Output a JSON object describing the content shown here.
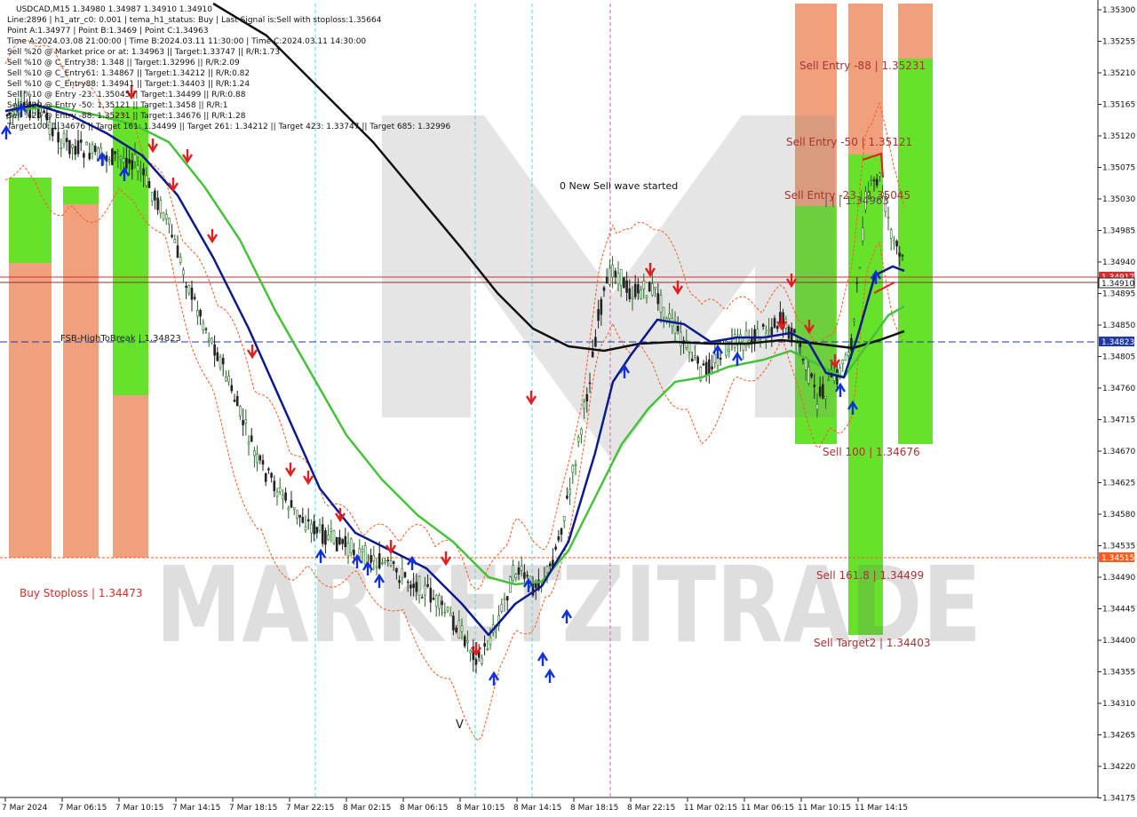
{
  "info": {
    "lines": [
      "USDCAD,M15  1.34980 1.34987 1.34910 1.34910",
      "Line:2896 | h1_atr_c0: 0.001 | tema_h1_status: Buy | Last Signal is:Sell with stoploss:1.35664",
      "Point A:1.34977 | Point B:1.3469 | Point C:1.34963",
      "Time A:2024.03.08 21:00:00 | Time B:2024.03.11 11:30:00 | Time C:2024.03.11 14:30:00",
      "Sell %20 @ Market price or at: 1.34963 || Target:1.33747 || R/R:1.73",
      "Sell %10 @ C_Entry38: 1.348 || Target:1.32996 || R/R:2.09",
      "Sell %10 @ C_Entry61: 1.34867 || Target:1.34212 || R/R:0.82",
      "Sell %10 @ C_Entry88: 1.34941 || Target:1.34403 || R/R:1.24",
      "Sell %10 @ Entry -23: 1.35045 || Target:1.34499 || R/R:0.88",
      "Sell %20 @ Entry -50: 1.35121 || Target:1.3458 || R/R:1",
      "Sell %20 @ Entry -88: 1.35231 || Target:1.34676 || R/R:1.28",
      "Target100: 1.34676 || Target 161: 1.34499 || Target 261: 1.34212 || Target 423: 1.33747 || Target 685: 1.32996"
    ]
  },
  "labels": {
    "new_wave": "0 New Sell wave started",
    "fsb": "FSB-HighToBreak | 1.34823",
    "buy_stoploss": "Buy Stoploss | 1.34473",
    "sell_entry_88": "Sell Entry -88 | 1.35231",
    "sell_entry_50": "Sell Entry -50 | 1.35121",
    "sell_entry_23": "Sell Entry -23 | 1.35045",
    "c_entry": "| | | 1.34963",
    "sell_100": "Sell 100 | 1.34676",
    "sell_161": "Sell 161.8 | 1.34499",
    "sell_target2": "Sell Target2 | 1.34403",
    "wave_v": "V",
    "watermark": "MARKETZITRADE"
  },
  "price_tags": {
    "current_1": "1.34917",
    "current_2": "1.34910",
    "fsb": "1.34823",
    "stop": "1.34515"
  },
  "colors": {
    "green_zone": "#66e22a",
    "salmon_zone": "#f0a07c",
    "candle_up": "#1f6b1f",
    "candle_down": "#222222",
    "sma_black": "#111111",
    "ema_navy": "#0b1a8c",
    "ema_green": "#45c23a",
    "channel_orange": "#ff5a1f",
    "vline_cyan": "#3ee0e6",
    "vline_magenta": "#e65aa8",
    "current_line": "#d23030",
    "fsb_line": "#1f3aa8",
    "buy_arrow": "#1030e0",
    "sell_arrow": "#e21f1f"
  },
  "axis": {
    "y_ticks": [
      "1.35300",
      "1.35255",
      "1.35210",
      "1.35165",
      "1.35120",
      "1.35075",
      "1.35030",
      "1.34985",
      "1.34940",
      "1.34895",
      "1.34850",
      "1.34805",
      "1.34760",
      "1.34715",
      "1.34670",
      "1.34625",
      "1.34580",
      "1.34535",
      "1.34490",
      "1.34445",
      "1.34400",
      "1.34355",
      "1.34310",
      "1.34265",
      "1.34220",
      "1.34175"
    ],
    "x_ticks": [
      "7 Mar 2024",
      "7 Mar 06:15",
      "7 Mar 10:15",
      "7 Mar 14:15",
      "7 Mar 18:15",
      "7 Mar 22:15",
      "8 Mar 02:15",
      "8 Mar 06:15",
      "8 Mar 10:15",
      "8 Mar 14:15",
      "8 Mar 18:15",
      "8 Mar 22:15",
      "11 Mar 02:15",
      "11 Mar 06:15",
      "11 Mar 10:15",
      "11 Mar 14:15"
    ]
  },
  "chart_data": {
    "type": "candlestick",
    "title": "USDCAD,M15",
    "ylim": [
      1.3416,
      1.3532
    ],
    "x": [
      "7 Mar 2024",
      "7 Mar 06:15",
      "7 Mar 10:15",
      "7 Mar 14:15",
      "7 Mar 18:15",
      "7 Mar 22:15",
      "8 Mar 02:15",
      "8 Mar 06:15",
      "8 Mar 10:15",
      "8 Mar 14:15",
      "8 Mar 18:15",
      "8 Mar 22:15",
      "11 Mar 02:15",
      "11 Mar 06:15",
      "11 Mar 10:15",
      "11 Mar 14:15"
    ],
    "close": [
      1.3513,
      1.3507,
      1.3502,
      1.3491,
      1.347,
      1.346,
      1.3452,
      1.3448,
      1.3438,
      1.3442,
      1.349,
      1.3485,
      1.3482,
      1.3481,
      1.3476,
      1.3491
    ],
    "sma_black": [
      1.353,
      1.3526,
      1.352,
      1.351,
      1.35,
      1.3491,
      1.3483,
      1.348,
      1.348,
      1.3481,
      1.3482,
      1.3483,
      1.3483,
      1.3482,
      1.3481,
      1.3483
    ],
    "ema_navy": [
      1.3513,
      1.351,
      1.35,
      1.3485,
      1.347,
      1.346,
      1.3454,
      1.345,
      1.3442,
      1.345,
      1.3478,
      1.3485,
      1.3483,
      1.3482,
      1.3478,
      1.3491
    ],
    "ema_green": [
      1.3512,
      1.351,
      1.3505,
      1.3495,
      1.3482,
      1.347,
      1.3462,
      1.3458,
      1.345,
      1.3451,
      1.3468,
      1.3476,
      1.3478,
      1.348,
      1.3478,
      1.3487
    ],
    "levels": {
      "current": 1.3491,
      "fsb_high_to_break": 1.34823,
      "buy_stoploss": 1.34473,
      "stop_tag": 1.34515,
      "sell_entry_88": 1.35231,
      "sell_entry_50": 1.35121,
      "sell_entry_23": 1.35045,
      "sell_100": 1.34676,
      "sell_161_8": 1.34499,
      "sell_target2": 1.34403
    }
  }
}
